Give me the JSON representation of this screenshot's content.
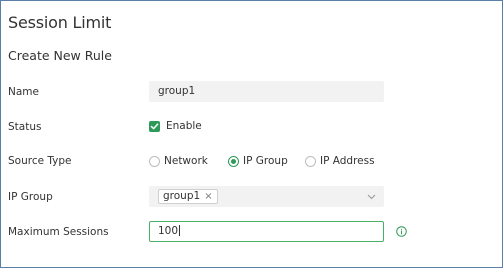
{
  "page": {
    "title": "Session Limit",
    "subtitle": "Create New Rule"
  },
  "form": {
    "name": {
      "label": "Name",
      "value": "group1"
    },
    "status": {
      "label": "Status",
      "checkbox_label": "Enable",
      "checked": true
    },
    "source_type": {
      "label": "Source Type",
      "options": [
        "Network",
        "IP Group",
        "IP Address"
      ],
      "selected": "IP Group"
    },
    "ip_group": {
      "label": "IP Group",
      "tag": "group1",
      "tag_remove": "×"
    },
    "max_sessions": {
      "label": "Maximum Sessions",
      "value": "100"
    }
  },
  "colors": {
    "accent": "#2e9a5a",
    "frame": "#5b7fa6",
    "field_bg": "#f2f2f2",
    "focus_border": "#4caf6a"
  },
  "icons": [
    "check-icon",
    "close-icon",
    "chevron-down-icon",
    "info-icon"
  ]
}
